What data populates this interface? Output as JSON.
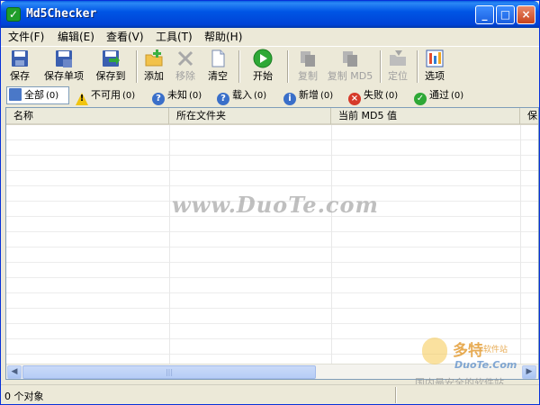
{
  "window": {
    "title": "Md5Checker",
    "controls": {
      "minimize": "_",
      "maximize": "□",
      "close": "×"
    }
  },
  "menu": [
    {
      "label": "文件(F)"
    },
    {
      "label": "编辑(E)"
    },
    {
      "label": "查看(V)"
    },
    {
      "label": "工具(T)"
    },
    {
      "label": "帮助(H)"
    }
  ],
  "toolbar": {
    "save": "保存",
    "save_item": "保存单项",
    "save_to": "保存到",
    "add": "添加",
    "remove": "移除",
    "clear": "清空",
    "start": "开始",
    "copy": "复制",
    "copy_md5": "复制 MD5",
    "locate": "定位",
    "options": "选项"
  },
  "filters": [
    {
      "label": "全部",
      "count": "(0)",
      "icon": "list-icon"
    },
    {
      "label": "不可用",
      "count": "(0)",
      "icon": "warning-icon"
    },
    {
      "label": "未知",
      "count": "(0)",
      "icon": "question-icon"
    },
    {
      "label": "载入",
      "count": "(0)",
      "icon": "load-icon"
    },
    {
      "label": "新增",
      "count": "(0)",
      "icon": "info-icon"
    },
    {
      "label": "失败",
      "count": "(0)",
      "icon": "fail-icon"
    },
    {
      "label": "通过",
      "count": "(0)",
      "icon": "pass-icon"
    }
  ],
  "columns": [
    "名称",
    "所在文件夹",
    "当前 MD5 值",
    "保"
  ],
  "status": {
    "text": "0 个对象"
  },
  "watermark": {
    "center": "www.DuoTe.com",
    "logo_big": "多特",
    "logo_small": "软件站",
    "logo_site": "DuoTe.Com",
    "logo_slogan": "国内最安全的软件站"
  }
}
